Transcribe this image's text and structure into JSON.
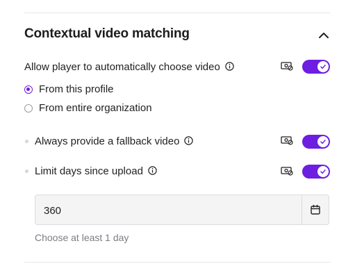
{
  "section": {
    "title": "Contextual video matching",
    "collapse_icon": "chevron-up-icon"
  },
  "auto_choose": {
    "label": "Allow player to automatically choose video",
    "enabled": true,
    "options": [
      {
        "label": "From this profile",
        "selected": true
      },
      {
        "label": "From entire organization",
        "selected": false
      }
    ]
  },
  "fallback": {
    "label": "Always provide a fallback video",
    "enabled": true
  },
  "limit_days": {
    "label": "Limit days since upload",
    "enabled": true,
    "value": "360",
    "hint": "Choose at least 1 day"
  },
  "icons": {
    "info": "info-icon",
    "monetization": "money-icon",
    "calendar": "calendar-icon",
    "check": "check-icon"
  },
  "colors": {
    "accent": "#6d1ee0",
    "text": "#1f1f22",
    "muted": "#7c7c84",
    "divider": "#e6e6e6"
  }
}
